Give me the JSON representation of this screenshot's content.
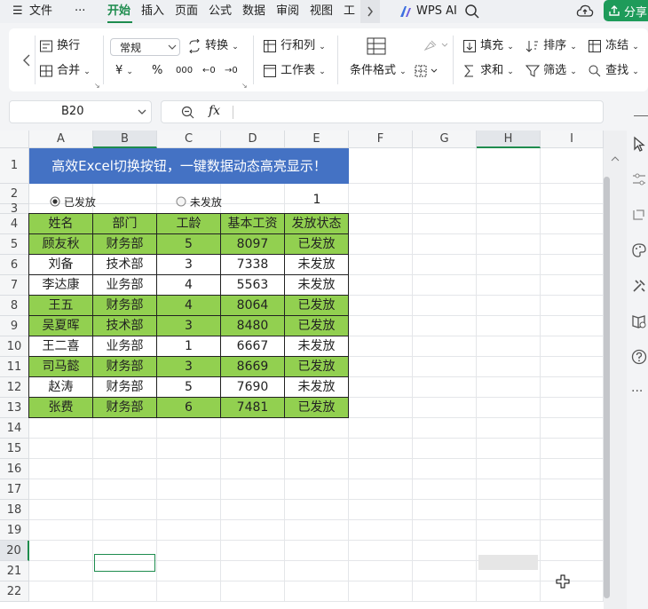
{
  "menu": {
    "hamburger": "☰",
    "file": "文件",
    "more": "···",
    "tabs": [
      "开始",
      "插入",
      "页面",
      "公式",
      "数据",
      "审阅",
      "视图",
      "工具"
    ],
    "wps_ai": "WPS AI",
    "share": "分享"
  },
  "ribbon": {
    "wrap": "换行",
    "merge": "合并",
    "number_format": "常规",
    "convert": "转换",
    "currency": "¥",
    "percent": "%",
    "thousands": "000",
    "dec_inc": "←0",
    "dec_dec": "→0",
    "rows_cols": "行和列",
    "worksheet": "工作表",
    "cond_format": "条件格式",
    "fill": "填充",
    "sort": "排序",
    "freeze": "冻结",
    "sum": "求和",
    "filter": "筛选",
    "find": "查找"
  },
  "formula_bar": {
    "cell_ref": "B20",
    "fx": "fx",
    "value": ""
  },
  "columns": [
    "A",
    "B",
    "C",
    "D",
    "E",
    "F",
    "G",
    "H",
    "I"
  ],
  "rows": [
    "1",
    "2",
    "3",
    "4",
    "5",
    "6",
    "7",
    "8",
    "9",
    "10",
    "11",
    "12",
    "13",
    "14",
    "15",
    "16",
    "17",
    "18",
    "19",
    "20",
    "21",
    "22"
  ],
  "sheet": {
    "title": "高效Excel切换按钮，一键数据动态高亮显示！",
    "radio_paid": "已发放",
    "radio_unpaid": "未发放",
    "radio_value": "1",
    "headers": [
      "姓名",
      "部门",
      "工龄",
      "基本工资",
      "发放状态"
    ],
    "data": [
      [
        "顾友秋",
        "财务部",
        "5",
        "8097",
        "已发放"
      ],
      [
        "刘备",
        "技术部",
        "3",
        "7338",
        "未发放"
      ],
      [
        "李达康",
        "业务部",
        "4",
        "5563",
        "未发放"
      ],
      [
        "王五",
        "财务部",
        "4",
        "8064",
        "已发放"
      ],
      [
        "吴夏晖",
        "技术部",
        "3",
        "8480",
        "已发放"
      ],
      [
        "王二喜",
        "业务部",
        "1",
        "6667",
        "未发放"
      ],
      [
        "司马懿",
        "财务部",
        "3",
        "8669",
        "已发放"
      ],
      [
        "赵涛",
        "财务部",
        "5",
        "7690",
        "未发放"
      ],
      [
        "张费",
        "财务部",
        "6",
        "7481",
        "已发放"
      ]
    ]
  },
  "colors": {
    "accent": "#1e8c4e",
    "title_bg": "#4472c4",
    "header_bg": "#92d050",
    "highlight_bg": "#92d050"
  }
}
